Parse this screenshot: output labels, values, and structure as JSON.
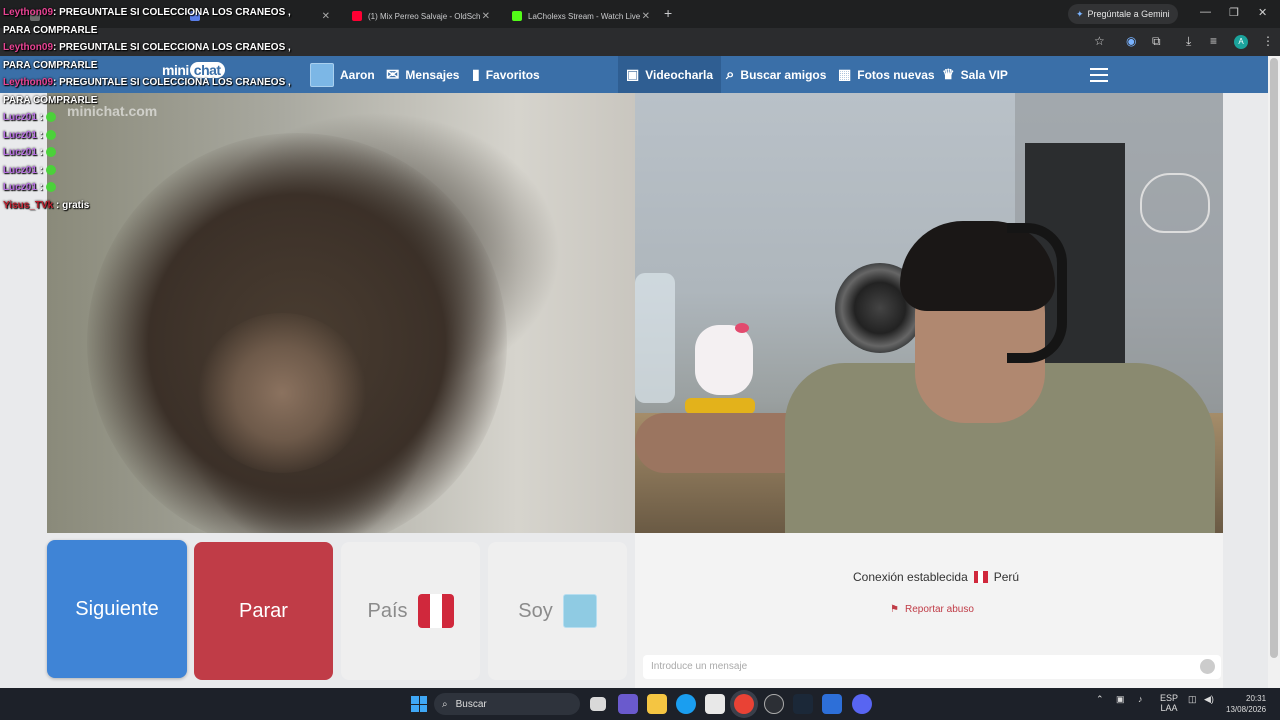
{
  "browser": {
    "tabs": [
      {
        "label": "",
        "color": "#6b6b6b"
      },
      {
        "label": "",
        "color": "#5a7ee8"
      },
      {
        "label": "(1) Mix Perreo Salvaje - OldSch",
        "color": "#ff0033"
      },
      {
        "label": "LaCholexs Stream - Watch Live",
        "color": "#53fc18"
      }
    ],
    "gemini_label": "Pregúntale a Gemini",
    "profile_letter": "A"
  },
  "site": {
    "logo_mini": "mini",
    "logo_chat": "chat",
    "nav": {
      "profile": "Aaron",
      "messages": "Mensajes",
      "favorites": "Favoritos",
      "videochat": "Videocharla",
      "find_friends": "Buscar amigos",
      "new_photos": "Fotos nuevas",
      "vip": "Sala VIP"
    },
    "watermark": "minichat.com"
  },
  "overlay_chat": [
    {
      "user": "Leython09",
      "user_color": "#e84393",
      "text": ": PREGUNTALE SI COLECCIONA LOS CRANEOS ,",
      "cont": "PARA COMPRARLE"
    },
    {
      "user": "Leython09",
      "user_color": "#e84393",
      "text": ": PREGUNTALE SI COLECCIONA LOS CRANEOS ,",
      "cont": "PARA COMPRARLE"
    },
    {
      "user": "Leython09",
      "user_color": "#e84393",
      "text": ": PREGUNTALE SI COLECCIONA LOS CRANEOS ,",
      "cont": "PARA COMPRARLE"
    },
    {
      "user": "Lucz01",
      "user_color": "#b56de0",
      "text": " :",
      "cont": ""
    },
    {
      "user": "Lucz01",
      "user_color": "#b56de0",
      "text": " :",
      "cont": ""
    },
    {
      "user": "Lucz01",
      "user_color": "#b56de0",
      "text": " :",
      "cont": ""
    },
    {
      "user": "Lucz01",
      "user_color": "#b56de0",
      "text": " :",
      "cont": ""
    },
    {
      "user": "Lucz01",
      "user_color": "#b56de0",
      "text": " :",
      "cont": ""
    },
    {
      "user": "Yisus_TVk",
      "user_color": "#c0202f",
      "text": " : gratis",
      "cont": ""
    }
  ],
  "controls": {
    "next": "Siguiente",
    "stop": "Parar",
    "country": "País",
    "soy": "Soy"
  },
  "status": {
    "connection": "Conexión establecida",
    "country": "Perú",
    "report": "Reportar abuso",
    "message_placeholder": "Introduce un mensaje"
  },
  "taskbar": {
    "search": "Buscar",
    "lang": "ESP",
    "region": "LAA",
    "time": "20:31",
    "date": "13/08/2026"
  },
  "colors": {
    "header_blue": "#3a6fa8",
    "next_blue": "#3f84d6",
    "stop_red": "#c03c47",
    "peru_red": "#d0283c"
  }
}
